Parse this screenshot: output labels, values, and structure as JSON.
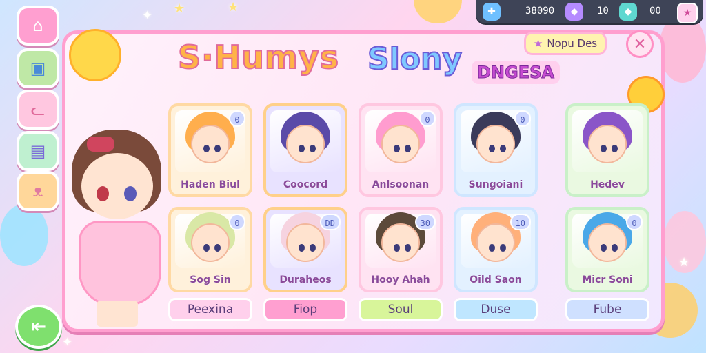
{
  "resources": {
    "coins": "38090",
    "gems": "10",
    "tickets": "00"
  },
  "title": {
    "part1": "S·Humys",
    "part2": "Slony",
    "part3": "DNGESA"
  },
  "top_pill_label": "Nopu Des",
  "sidebar": [
    {
      "name": "home-icon",
      "glyph": "⌂"
    },
    {
      "name": "map-icon",
      "glyph": "▣"
    },
    {
      "name": "cat-icon",
      "glyph": "ᓚ"
    },
    {
      "name": "box-icon",
      "glyph": "▤"
    },
    {
      "name": "pig-icon",
      "glyph": "ᴥ"
    }
  ],
  "cards_top": [
    {
      "name": "Haden Biul",
      "badge": "0",
      "hair": "#ffae4d"
    },
    {
      "name": "Coocord",
      "badge": "",
      "hair": "#5a4aa8"
    },
    {
      "name": "Anlsoonan",
      "badge": "0",
      "hair": "#ff9ccf"
    },
    {
      "name": "Sungoiani",
      "badge": "0",
      "hair": "#3a3a5a"
    },
    {
      "name": "Hedev",
      "badge": "",
      "hair": "#8a55c8"
    }
  ],
  "cards_bottom": [
    {
      "name": "Sog Sin",
      "badge": "0",
      "hair": "#d9e8a6"
    },
    {
      "name": "Duraheos",
      "badge": "DD",
      "hair": "#f6d3e0"
    },
    {
      "name": "Hooy Ahah",
      "badge": "30",
      "hair": "#5c4a3a"
    },
    {
      "name": "Oild Saon",
      "badge": "10",
      "hair": "#ffb07a"
    },
    {
      "name": "Micr Soni",
      "badge": "0",
      "hair": "#4aa8e8"
    }
  ],
  "buttons_bottom": [
    {
      "label": "Peexina",
      "color": "#ffd0ec"
    },
    {
      "label": "Fiop",
      "color": "#ff9fd0"
    },
    {
      "label": "Soul",
      "color": "#d8f59a"
    },
    {
      "label": "Duse",
      "color": "#bfe6ff"
    },
    {
      "label": "Fube",
      "color": "#cfe0ff"
    }
  ],
  "colors": {
    "panel_border": "#ff9fcf",
    "accent_pink": "#ff86b8",
    "topbar": "#3e4457"
  }
}
